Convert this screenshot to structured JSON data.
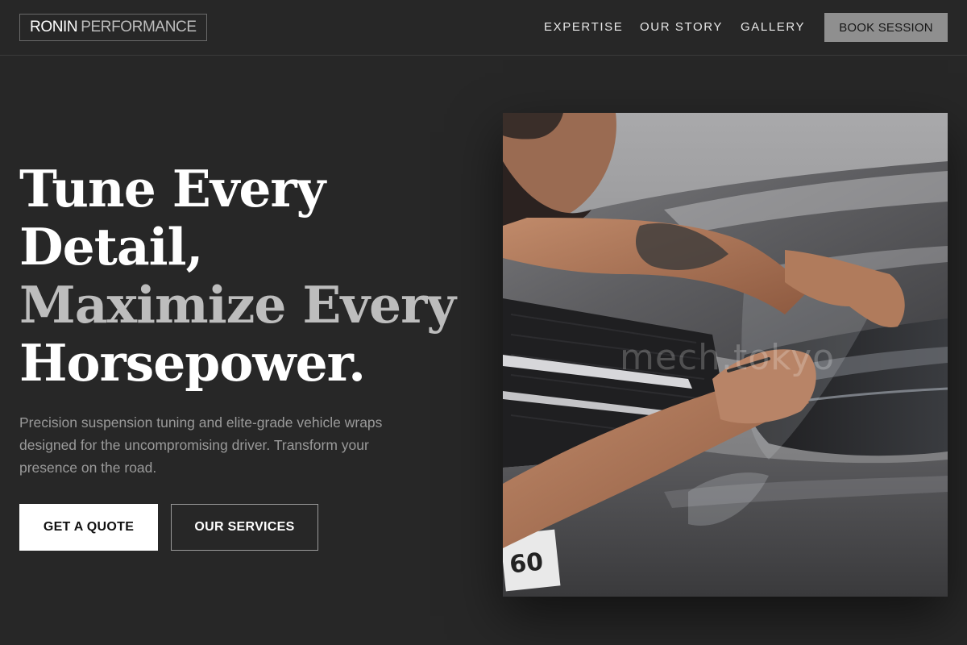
{
  "header": {
    "logo_primary": "RONIN",
    "logo_secondary": "PERFORMANCE",
    "nav": {
      "expertise": "EXPERTISE",
      "our_story": "OUR STORY",
      "gallery": "GALLERY"
    },
    "book_label": "BOOK SESSION"
  },
  "hero": {
    "line1": "Tune Every",
    "line2": "Detail,",
    "line3": "Maximize Every",
    "line4": "Horsepower.",
    "subtext": "Precision suspension tuning and elite-grade vehicle wraps designed for the uncompromising driver. Transform your presence on the road.",
    "quote_label": "GET A QUOTE",
    "services_label": "OUR SERVICES",
    "image_watermark": "mech.tokyo",
    "plate_text": "60"
  },
  "colors": {
    "background": "#272727",
    "accent_gray": "#8f8f8f",
    "headline_white": "#ffffff",
    "headline_gray": "#bdbdbd",
    "body_text": "#9a9a9a"
  }
}
